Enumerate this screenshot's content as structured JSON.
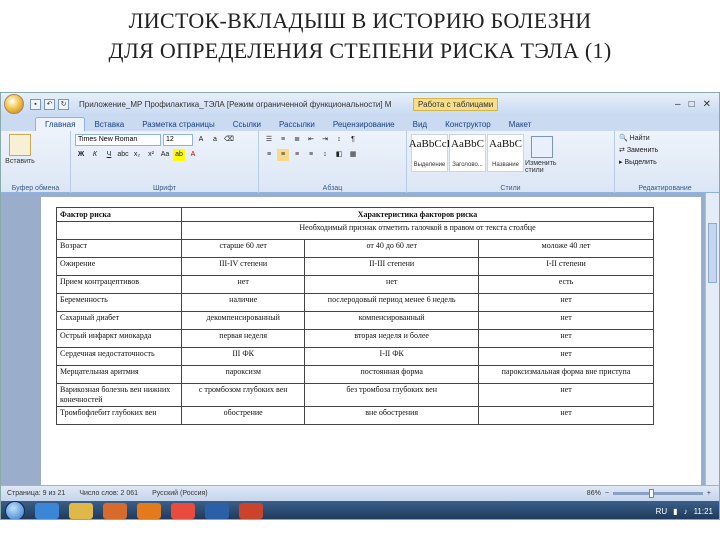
{
  "slide": {
    "title_line1": "ЛИСТОК-ВКЛАДЫШ В ИСТОРИЮ БОЛЕЗНИ",
    "title_line2": "ДЛЯ ОПРЕДЕЛЕНИЯ СТЕПЕНИ РИСКА ТЭЛА (1)"
  },
  "titlebar": {
    "doc_title": "Приложение_МР Профилактика_ТЭЛА [Режим ограниченной функциональности] М",
    "context_tab": "Работа с таблицами",
    "min": "–",
    "max": "□",
    "close": "✕"
  },
  "tabs": [
    "Главная",
    "Вставка",
    "Разметка страницы",
    "Ссылки",
    "Рассылки",
    "Рецензирование",
    "Вид",
    "Конструктор",
    "Макет"
  ],
  "ribbon": {
    "clipboard": {
      "paste": "Вставить",
      "label": "Буфер обмена"
    },
    "font": {
      "name": "Times New Roman",
      "size": "12",
      "label": "Шрифт"
    },
    "paragraph": {
      "label": "Абзац"
    },
    "styles": {
      "label": "Стили",
      "cards": [
        {
          "sample": "AaBbCcI",
          "name": "Выделение"
        },
        {
          "sample": "AaBbC",
          "name": "Заголово..."
        },
        {
          "sample": "AaBbC",
          "name": "Название"
        }
      ],
      "change": "Изменить стили"
    },
    "editing": {
      "label": "Редактирование",
      "find": "Найти",
      "replace": "Заменить",
      "select": "Выделить"
    }
  },
  "table": {
    "header": {
      "factor": "Фактор риска",
      "char": "Характеристика факторов риска"
    },
    "subheader": "Необходимый признак отметить галочкой в правом от текста столбце",
    "rows": [
      [
        "Возраст",
        "старше 60 лет",
        "от 40 до 60 лет",
        "моложе 40 лет"
      ],
      [
        "Ожирение",
        "III-IV степени",
        "II-III степени",
        "I-II степени"
      ],
      [
        "Прием контрацептивов",
        "нет",
        "нет",
        "есть"
      ],
      [
        "Беременность",
        "наличие",
        "послеродовый период менее 6 недель",
        "нет"
      ],
      [
        "Сахарный диабет",
        "декомпенсированный",
        "компенсированный",
        "нет"
      ],
      [
        "Острый инфаркт миокарда",
        "первая неделя",
        "вторая неделя и более",
        "нет"
      ],
      [
        "Сердечная недостаточность",
        "III ФК",
        "I-II ФК",
        "нет"
      ],
      [
        "Мерцательная аритмия",
        "пароксизм",
        "постоянная форма",
        "пароксизмальная форма вне приступа"
      ],
      [
        "Варикозная болезнь вен нижних конечностей",
        "с тромбозом глубоких вен",
        "без тромбоза глубоких вен",
        "нет"
      ],
      [
        "Тромбофлебит глубоких вен",
        "обострение",
        "вне обострения",
        "нет"
      ]
    ]
  },
  "status": {
    "page": "Страница: 9 из 21",
    "words": "Число слов: 2 061",
    "lang": "Русский (Россия)",
    "zoom": "86%",
    "zoom_fraction": 0.43
  },
  "tray": {
    "lang": "RU",
    "time": "11:21"
  },
  "colors": {
    "ribbon": "#dbe6f5",
    "accent": "#15428b",
    "taskbar": "#1c3656"
  }
}
